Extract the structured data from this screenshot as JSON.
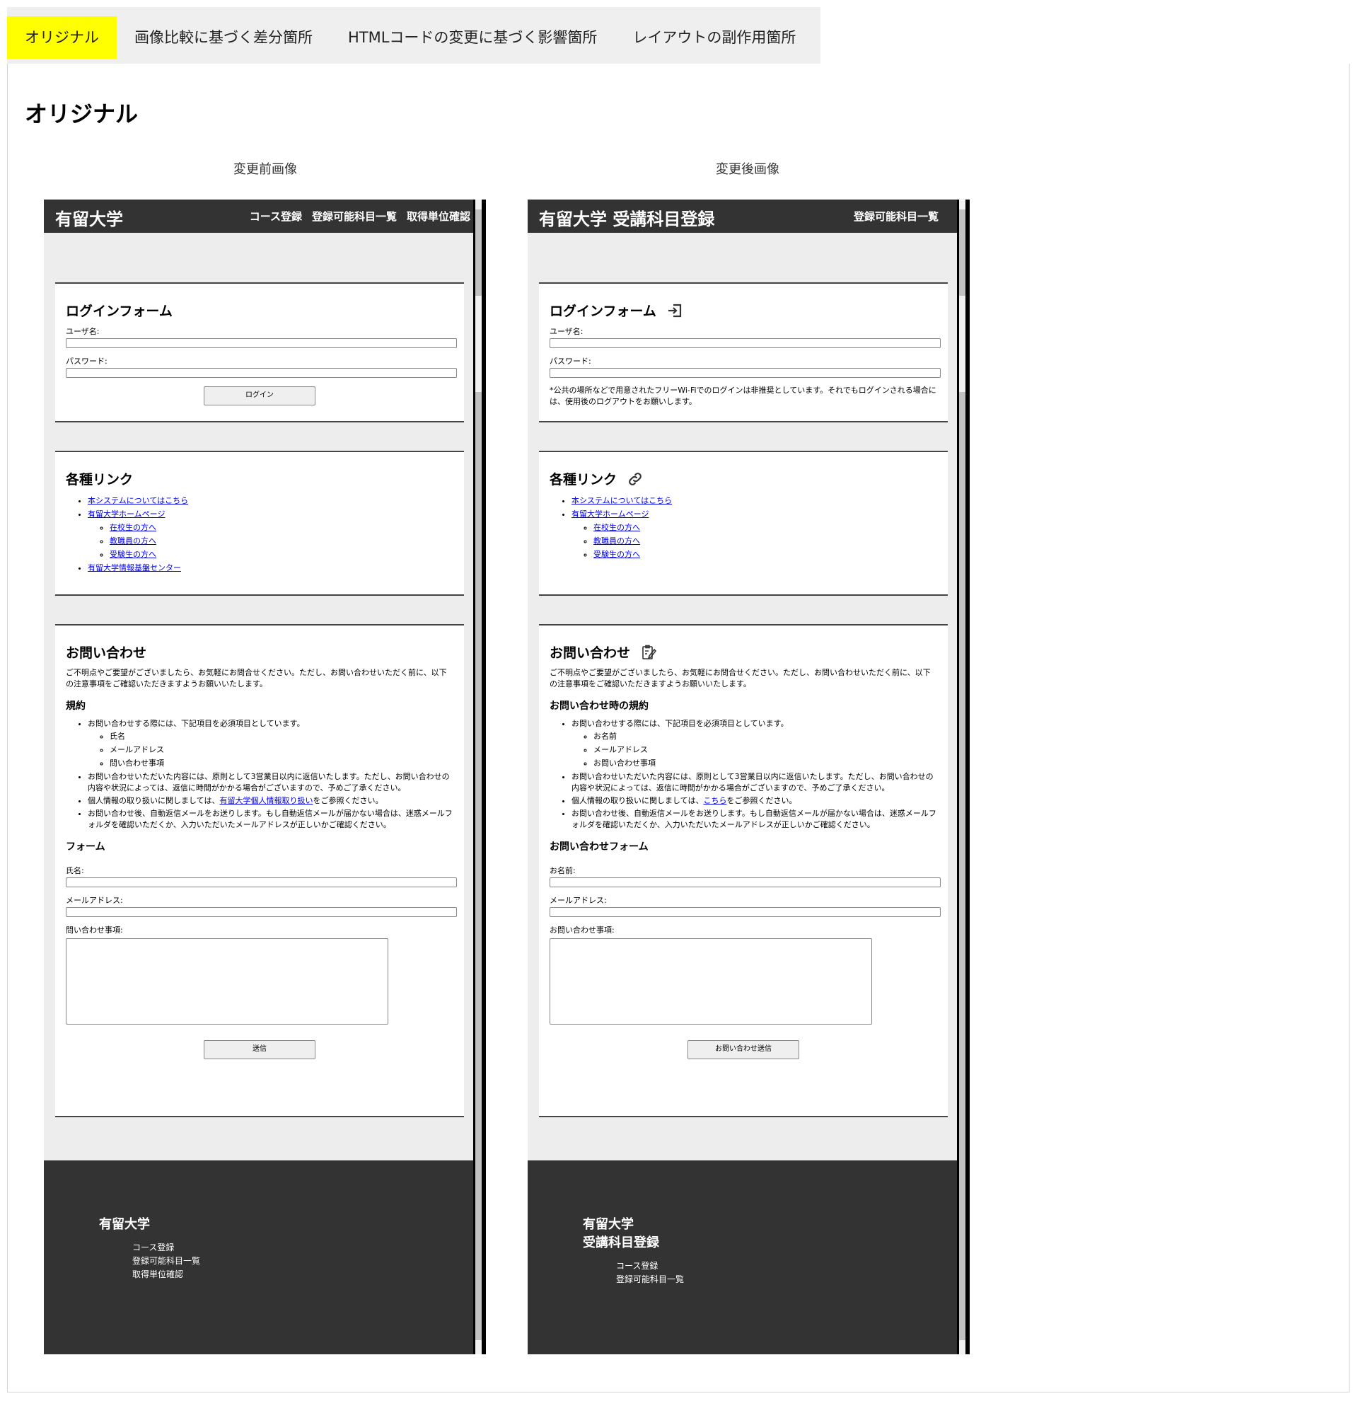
{
  "tabs": [
    "オリジナル",
    "画像比較に基づく差分箇所",
    "HTMLコードの変更に基づく影響箇所",
    "レイアウトの副作用箇所"
  ],
  "heading": "オリジナル",
  "before_caption": "変更前画像",
  "after_caption": "変更後画像",
  "before": {
    "brand": "有留大学",
    "nav": [
      "コース登録",
      "登録可能科目一覧",
      "取得単位確認"
    ],
    "login": {
      "title": "ログインフォーム",
      "user_label": "ユーザ名:",
      "pass_label": "パスワード:",
      "button": "ログイン"
    },
    "links": {
      "title": "各種リンク",
      "l1": "本システムについてはこちら",
      "l2": "有留大学ホームページ",
      "l2a": "在校生の方へ",
      "l2b": "教職員の方へ",
      "l2c": "受験生の方へ",
      "l3": "有留大学情報基盤センター"
    },
    "contact": {
      "title": "お問い合わせ",
      "intro": "ご不明点やご要望がございましたら、お気軽にお問合せください。ただし、お問い合わせいただく前に、以下の注意事項をご確認いただきますようお願いいたします。",
      "rules_title": "規約",
      "r1": "お問い合わせする際には、下記項目を必須項目としています。",
      "r1a": "氏名",
      "r1b": "メールアドレス",
      "r1c": "問い合わせ事項",
      "r2": "お問い合わせいただいた内容には、原則として3営業日以内に返信いたします。ただし、お問い合わせの内容や状況によっては、返信に時間がかかる場合がございますので、予めご了承ください。",
      "r3_pre": "個人情報の取り扱いに関しましては、",
      "r3_link": "有留大学個人情報取り扱い",
      "r3_post": "をご参照ください。",
      "r4": "お問い合わせ後、自動返信メールをお送りします。もし自動返信メールが届かない場合は、迷惑メールフォルダを確認いただくか、入力いただいたメールアドレスが正しいかご確認ください。",
      "form_title": "フォーム",
      "name_label": "氏名:",
      "email_label": "メールアドレス:",
      "msg_label": "問い合わせ事項:",
      "button": "送信"
    },
    "footer": {
      "brand": "有留大学",
      "items": [
        "コース登録",
        "登録可能科目一覧",
        "取得単位確認"
      ]
    }
  },
  "after": {
    "brand": "有留大学 受講科目登録",
    "nav": [
      "登録可能科目一覧"
    ],
    "login": {
      "title": "ログインフォーム",
      "user_label": "ユーザ名:",
      "pass_label": "パスワード:",
      "note": "*公共の場所などで用意されたフリーWi-Fiでのログインは非推奨としています。それでもログインされる場合には、使用後のログアウトをお願いします。"
    },
    "links": {
      "title": "各種リンク",
      "l1": "本システムについてはこちら",
      "l2": "有留大学ホームページ",
      "l2a": "在校生の方へ",
      "l2b": "教職員の方へ",
      "l2c": "受験生の方へ"
    },
    "contact": {
      "title": "お問い合わせ",
      "intro": "ご不明点やご要望がございましたら、お気軽にお問合せください。ただし、お問い合わせいただく前に、以下の注意事項をご確認いただきますようお願いいたします。",
      "rules_title": "お問い合わせ時の規約",
      "r1": "お問い合わせする際には、下記項目を必須項目としています。",
      "r1a": "お名前",
      "r1b": "メールアドレス",
      "r1c": "お問い合わせ事項",
      "r2": "お問い合わせいただいた内容には、原則として3営業日以内に返信いたします。ただし、お問い合わせの内容や状況によっては、返信に時間がかかる場合がございますので、予めご了承ください。",
      "r3_pre": "個人情報の取り扱いに関しましては、",
      "r3_link": "こちら",
      "r3_post": "をご参照ください。",
      "r4": "お問い合わせ後、自動返信メールをお送りします。もし自動返信メールが届かない場合は、迷惑メールフォルダを確認いただくか、入力いただいたメールアドレスが正しいかご確認ください。",
      "form_title": "お問い合わせフォーム",
      "name_label": "お名前:",
      "email_label": "メールアドレス:",
      "msg_label": "お問い合わせ事項:",
      "button": "お問い合わせ送信"
    },
    "footer": {
      "brand_line1": "有留大学",
      "brand_line2": "受講科目登録",
      "items": [
        "コース登録",
        "登録可能科目一覧"
      ]
    }
  },
  "colors": {
    "active_tab": "#ffff00",
    "header_bg": "#333333",
    "page_bg": "#ededed",
    "link": "#0000ee"
  },
  "icons": {
    "login": "login-icon",
    "links": "link-icon",
    "contact": "clipboard-edit-icon"
  }
}
